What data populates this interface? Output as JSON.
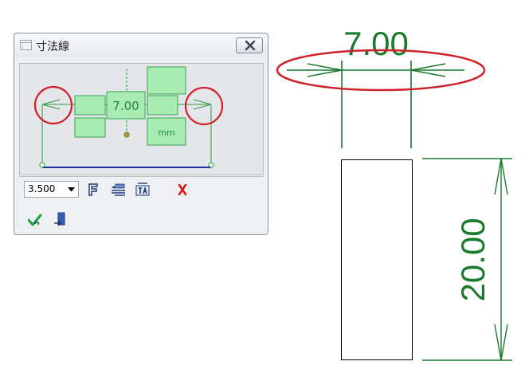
{
  "dialog": {
    "title": "寸法線",
    "preview": {
      "value_label": "7.00",
      "unit_label": "mm"
    },
    "toolbar": {
      "text_size_value": "3.500"
    }
  },
  "drawing": {
    "horizontal_dimension": "7.00",
    "vertical_dimension": "20.00"
  },
  "colors": {
    "dimension_green": "#1a7a2e",
    "highlight_red": "#d0202a",
    "preview_green": "#a8ecb4",
    "baseline_blue": "#1c2fa8"
  },
  "icons": [
    "dialog-app-icon",
    "close-icon",
    "font-icon",
    "text-position-icon",
    "text-format-icon",
    "delete-icon",
    "ok-check-icon",
    "exit-icon"
  ]
}
